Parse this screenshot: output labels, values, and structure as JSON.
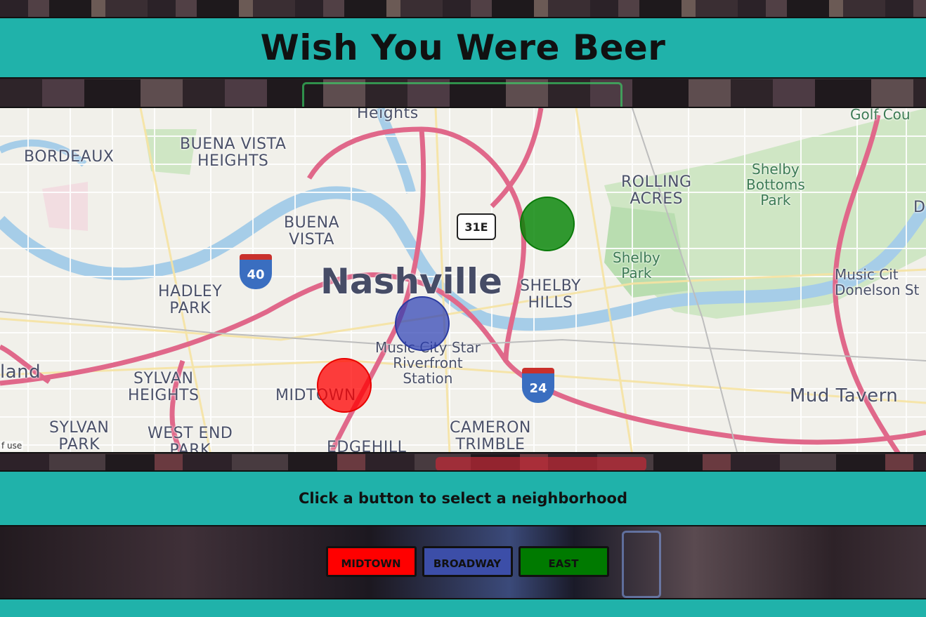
{
  "header": {
    "title": "Wish You Were Beer"
  },
  "map": {
    "city_label": "Nashville",
    "neighborhood_labels": [
      "BORDEAUX",
      "BUENA VISTA\nHEIGHTS",
      "BUENA\nVISTA",
      "HADLEY\nPARK",
      "SYLVAN\nHEIGHTS",
      "MIDTOWN",
      "SYLVAN\nPARK",
      "WEST END\nPARK",
      "EDGEHILL",
      "CAMERON\nTRIMBLE",
      "SHELBY\nHILLS",
      "ROLLING\nACRES",
      "Heights",
      "land"
    ],
    "park_labels": [
      "Shelby\nBottoms\nPark",
      "Shelby\nPark",
      "Golf Cou"
    ],
    "poi_labels": [
      "Music City Star\nRiverfront\nStation",
      "Music Cit\nDonelson St",
      "Mud Tavern"
    ],
    "shields": [
      "40",
      "31E",
      "24"
    ],
    "edge_labels": [
      "D"
    ],
    "terms_text": "f use",
    "markers": [
      {
        "name": "MIDTOWN",
        "color": "#ff0000"
      },
      {
        "name": "BROADWAY",
        "color": "#3c4ea8"
      },
      {
        "name": "EAST",
        "color": "#007a00"
      }
    ]
  },
  "prompt": {
    "text": "Click a button to select a neighborhood"
  },
  "buttons": [
    {
      "label": "MIDTOWN",
      "color": "#ff0000"
    },
    {
      "label": "BROADWAY",
      "color": "#3c4ea8"
    },
    {
      "label": "EAST",
      "color": "#007a00"
    }
  ]
}
